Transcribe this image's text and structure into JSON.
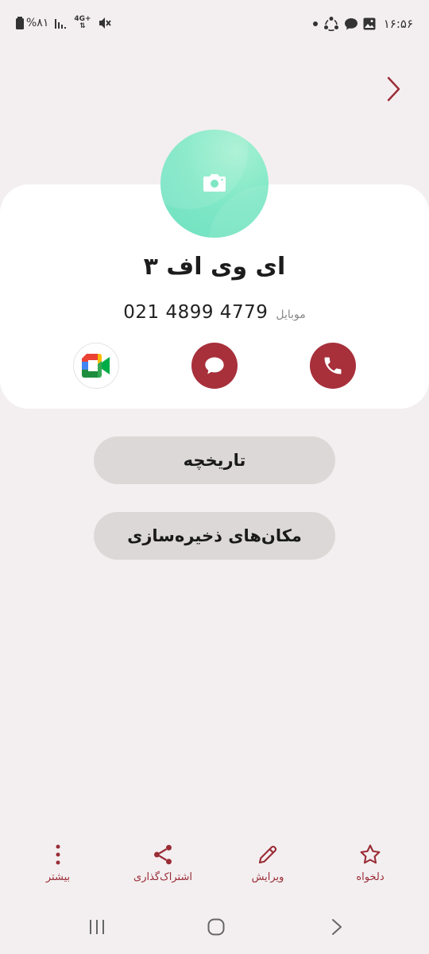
{
  "status_bar": {
    "time": "۱۶:۵۶",
    "battery": "%۸۱",
    "network": "4G+"
  },
  "contact": {
    "name": "ای وی اف ۳",
    "phone_type": "موبایل",
    "phone_number": "021 4899 4779"
  },
  "buttons": {
    "history_label": "تاریخچه",
    "storage_label": "مکان‌های ذخیره‌سازی"
  },
  "bottom_bar": {
    "favorite_label": "دلخواه",
    "edit_label": "ویرایش",
    "share_label": "اشتراک‌گذاری",
    "more_label": "بیشتر"
  },
  "colors": {
    "accent": "#a7303b",
    "background": "#f3eff0",
    "card": "#ffffff",
    "pill": "#dcd8d8",
    "avatar": "#80e8c6"
  },
  "icons": [
    "battery-icon",
    "signal-icon",
    "mute-icon",
    "dot-icon",
    "share-network-icon",
    "chat-bubble-icon",
    "image-icon",
    "back-chevron-icon",
    "camera-icon",
    "phone-icon",
    "message-icon",
    "google-meet-icon",
    "star-icon",
    "pencil-icon",
    "share-icon",
    "more-vert-icon",
    "recents-icon",
    "home-icon",
    "back-icon"
  ]
}
